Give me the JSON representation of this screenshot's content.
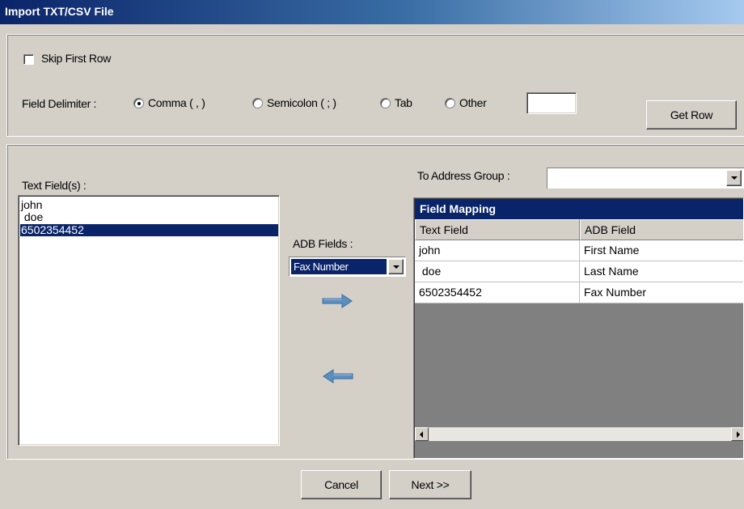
{
  "window": {
    "title": "Import TXT/CSV File"
  },
  "options": {
    "skip_first_row_label": "Skip First Row",
    "skip_first_row_checked": false,
    "delimiter_label": "Field Delimiter :",
    "delimiters": [
      {
        "label": "Comma ( , )",
        "checked": true
      },
      {
        "label": "Semicolon ( ; )",
        "checked": false
      },
      {
        "label": "Tab",
        "checked": false
      },
      {
        "label": "Other",
        "checked": false
      }
    ],
    "other_value": "",
    "get_row_label": "Get Row"
  },
  "text_fields": {
    "label": "Text Field(s) :",
    "items": [
      "john",
      " doe",
      "6502354452"
    ],
    "selected_index": 2
  },
  "adb_fields": {
    "label": "ADB Fields :",
    "selected": "Fax Number"
  },
  "address_group": {
    "label": "To Address Group :",
    "value": ""
  },
  "mapping": {
    "title": "Field Mapping",
    "columns": [
      "Text Field",
      "ADB Field"
    ],
    "rows": [
      [
        "john",
        "First Name"
      ],
      [
        " doe",
        "Last Name"
      ],
      [
        "6502354452",
        "Fax Number"
      ]
    ]
  },
  "footer": {
    "cancel_label": "Cancel",
    "next_label": "Next >>"
  },
  "colors": {
    "selection": "#0a246a",
    "arrow": "#5b8fc0",
    "grid_background": "#808080"
  }
}
